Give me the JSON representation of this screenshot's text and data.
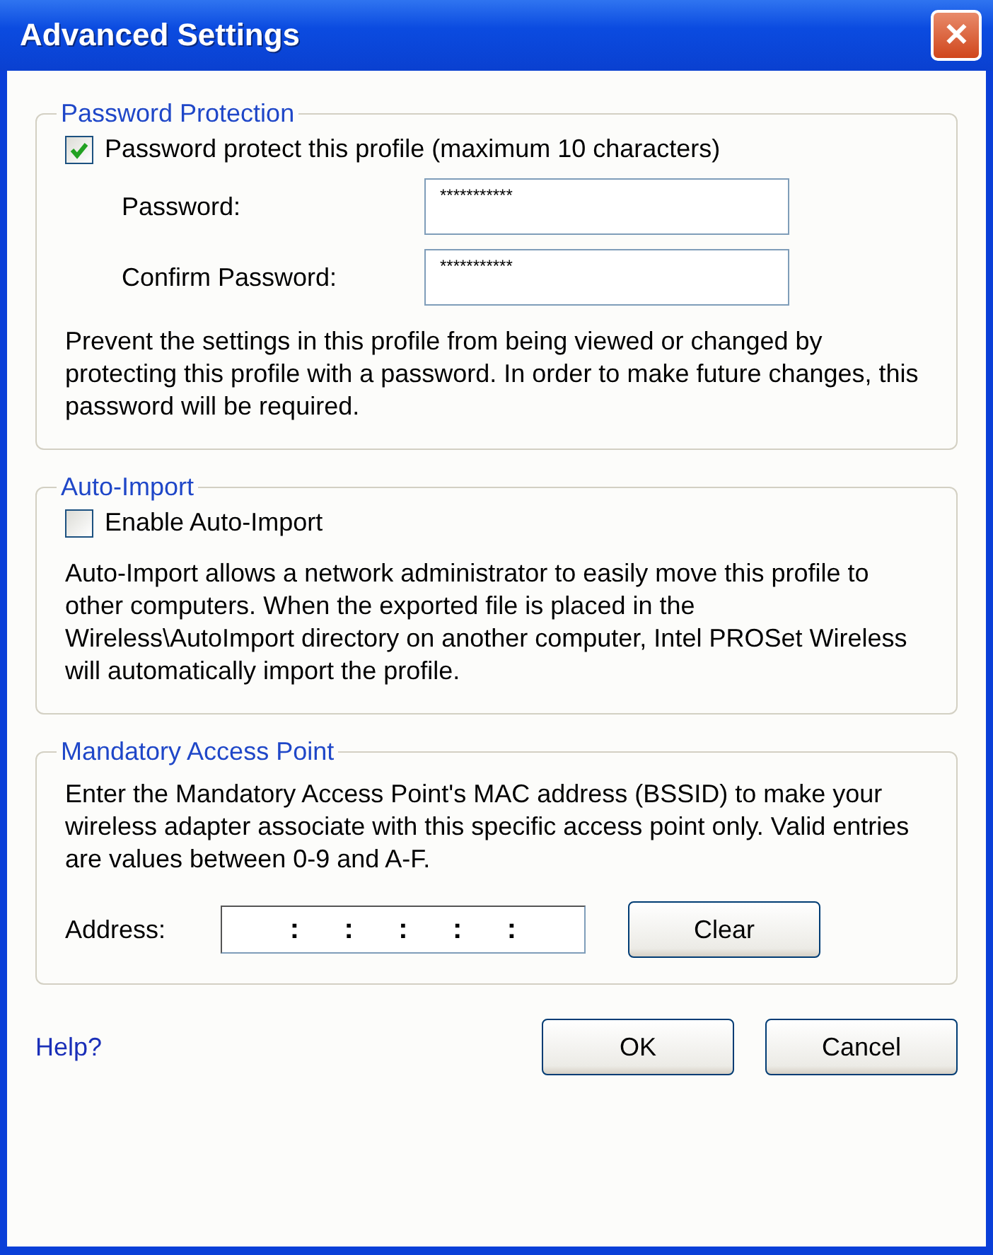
{
  "window": {
    "title": "Advanced Settings",
    "close": "✕"
  },
  "password_protection": {
    "title": "Password Protection",
    "checkbox": {
      "label": "Password protect this profile (maximum 10 characters)",
      "checked": true
    },
    "fields": [
      {
        "label": "Password:",
        "value": "***********"
      },
      {
        "label": "Confirm Password:",
        "value": "***********"
      }
    ],
    "description": "Prevent the settings in this profile from being viewed or changed by protecting this profile with a password. In order to make future changes, this password will be required."
  },
  "auto_import": {
    "title": "Auto-Import",
    "checkbox": {
      "label": "Enable Auto-Import",
      "checked": false
    },
    "description": "Auto-Import allows a network administrator to easily move this profile to other computers. When the exported file is placed in the Wireless\\AutoImport directory on another computer, Intel PROSet Wireless will automatically import the profile."
  },
  "mandatory_access_point": {
    "title": "Mandatory Access Point",
    "description": "Enter the Mandatory Access Point's MAC address (BSSID) to make your wireless adapter associate with this specific access point only. Valid entries are values between 0-9 and A-F.",
    "address_label": "Address:",
    "separators": [
      ":",
      ":",
      ":",
      ":",
      ":"
    ],
    "clear_button": "Clear"
  },
  "footer": {
    "help_link": "Help?",
    "buttons": [
      "OK",
      "Cancel"
    ]
  }
}
